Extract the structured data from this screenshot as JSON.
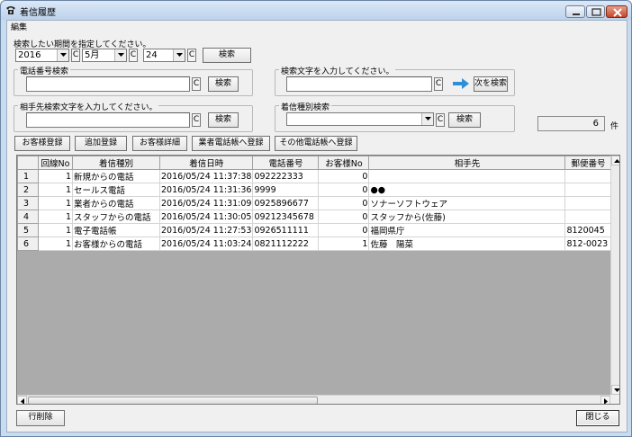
{
  "window": {
    "title": "着信履歴"
  },
  "menu": {
    "edit": "編集"
  },
  "period": {
    "label": "検索したい期間を指定してください。",
    "year": "2016",
    "month": "5月",
    "day": "24",
    "clear": "C",
    "search_button": "検索"
  },
  "phone_search": {
    "group_title": "電話番号検索",
    "value": "",
    "clear": "C",
    "search_button": "検索"
  },
  "text_search": {
    "group_title": "検索文字を入力してください。",
    "value": "",
    "clear": "C",
    "next_button": "次を検索"
  },
  "partner_search": {
    "group_title": "相手先検索文字を入力してください。",
    "value": "",
    "clear": "C",
    "search_button": "検索"
  },
  "type_search": {
    "group_title": "着信種別検索",
    "value": "",
    "clear": "C",
    "search_button": "検索"
  },
  "count": {
    "value": "6",
    "unit": "件"
  },
  "actions": {
    "customer_register": "お客様登録",
    "add_register": "追加登録",
    "customer_detail": "お客様詳細",
    "vendor_phonebook": "業者電話帳へ登録",
    "other_phonebook": "その他電話帳へ登録"
  },
  "table": {
    "headers": [
      "",
      "回線No",
      "着信種別",
      "着信日時",
      "電話番号",
      "お客様No",
      "相手先",
      "郵便番号"
    ],
    "rows": [
      [
        "1",
        "1",
        "新規からの電話",
        "2016/05/24 11:37:38",
        "092222333",
        "0",
        "",
        ""
      ],
      [
        "2",
        "1",
        "セールス電話",
        "2016/05/24 11:31:36",
        "9999",
        "0",
        "●●",
        ""
      ],
      [
        "3",
        "1",
        "業者からの電話",
        "2016/05/24 11:31:09",
        "0925896677",
        "0",
        "ソナーソフトウェア",
        ""
      ],
      [
        "4",
        "1",
        "スタッフからの電話",
        "2016/05/24 11:30:05",
        "09212345678",
        "0",
        "スタッフから(佐藤)",
        ""
      ],
      [
        "5",
        "1",
        "電子電話帳",
        "2016/05/24 11:27:53",
        "0926511111",
        "0",
        "福岡県庁",
        "8120045"
      ],
      [
        "6",
        "1",
        "お客様からの電話",
        "2016/05/24 11:03:24",
        "0821112222",
        "1",
        "佐藤　陽菜",
        "812-0023"
      ]
    ]
  },
  "footer": {
    "delete_row": "行削除",
    "close": "閉じる"
  }
}
